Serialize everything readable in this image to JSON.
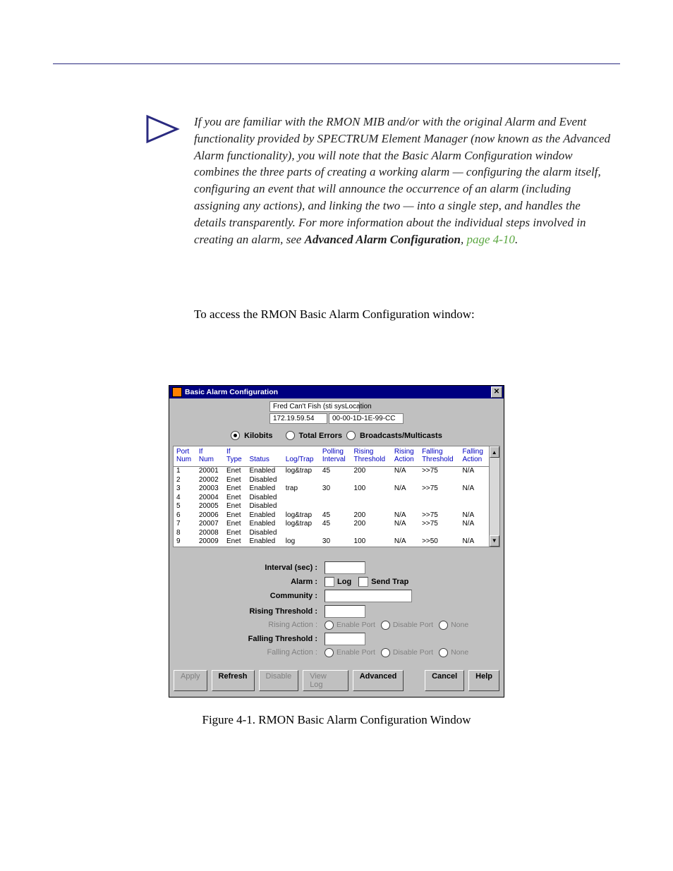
{
  "note": {
    "paragraph_pre": "If you are familiar with the RMON MIB and/or with the original Alarm and Event functionality provided by SPECTRUM Element Manager (now known as the Advanced Alarm functionality), you will note that the Basic Alarm Configuration window combines the three parts of creating a working alarm — configuring the alarm itself, configuring an event that will announce the occurrence of an alarm (including assigning any actions), and linking the two — into a single step, and handles the details transparently. For more information about the individual steps involved in creating an alarm, see ",
    "bold": "Advanced Alarm Configuration",
    "sep": ", ",
    "link": "page 4-10",
    "tail": "."
  },
  "access_line": "To access the RMON Basic Alarm Configuration window:",
  "win": {
    "title": "Basic Alarm Configuration",
    "close": "✕",
    "info": {
      "name": "Fred Can't Fish (sti sysLocation",
      "ip": "172.19.59.54",
      "mac": "00-00-1D-1E-99-CC"
    },
    "radios": {
      "kilobits": "Kilobits",
      "total_errors": "Total Errors",
      "bcast": "Broadcasts/Multicasts"
    },
    "headers": {
      "port_num": "Port\nNum",
      "if_num": "If\nNum",
      "if_type": "If\nType",
      "status": "Status",
      "log_trap": "Log/Trap",
      "polling": "Polling\nInterval",
      "rising_th": "Rising\nThreshold",
      "rising_ac": "Rising\nAction",
      "falling_th": "Falling\nThreshold",
      "falling_ac": "Falling\nAction"
    },
    "rows": [
      {
        "port": "1",
        "ifnum": "20001",
        "iftype": "Enet",
        "status": "Enabled",
        "lt": "log&trap",
        "poll": "45",
        "rth": "200",
        "rac": "N/A",
        "fth": ">>75",
        "fac": "N/A"
      },
      {
        "port": "2",
        "ifnum": "20002",
        "iftype": "Enet",
        "status": "Disabled",
        "lt": "",
        "poll": "",
        "rth": "",
        "rac": "",
        "fth": "",
        "fac": ""
      },
      {
        "port": "3",
        "ifnum": "20003",
        "iftype": "Enet",
        "status": "Enabled",
        "lt": "trap",
        "poll": "30",
        "rth": "100",
        "rac": "N/A",
        "fth": ">>75",
        "fac": "N/A"
      },
      {
        "port": "4",
        "ifnum": "20004",
        "iftype": "Enet",
        "status": "Disabled",
        "lt": "",
        "poll": "",
        "rth": "",
        "rac": "",
        "fth": "",
        "fac": ""
      },
      {
        "port": "5",
        "ifnum": "20005",
        "iftype": "Enet",
        "status": "Disabled",
        "lt": "",
        "poll": "",
        "rth": "",
        "rac": "",
        "fth": "",
        "fac": ""
      },
      {
        "port": "6",
        "ifnum": "20006",
        "iftype": "Enet",
        "status": "Enabled",
        "lt": "log&trap",
        "poll": "45",
        "rth": "200",
        "rac": "N/A",
        "fth": ">>75",
        "fac": "N/A"
      },
      {
        "port": "7",
        "ifnum": "20007",
        "iftype": "Enet",
        "status": "Enabled",
        "lt": "log&trap",
        "poll": "45",
        "rth": "200",
        "rac": "N/A",
        "fth": ">>75",
        "fac": "N/A"
      },
      {
        "port": "8",
        "ifnum": "20008",
        "iftype": "Enet",
        "status": "Disabled",
        "lt": "",
        "poll": "",
        "rth": "",
        "rac": "",
        "fth": "",
        "fac": ""
      },
      {
        "port": "9",
        "ifnum": "20009",
        "iftype": "Enet",
        "status": "Enabled",
        "lt": "log",
        "poll": "30",
        "rth": "100",
        "rac": "N/A",
        "fth": ">>50",
        "fac": "N/A"
      }
    ],
    "form": {
      "interval": "Interval (sec) :",
      "alarm": "Alarm :",
      "log": "Log",
      "send_trap": "Send Trap",
      "community": "Community :",
      "rising_th": "Rising Threshold :",
      "rising_ac": "Rising Action :",
      "falling_th": "Falling Threshold :",
      "falling_ac": "Falling Action :",
      "enable_port": "Enable Port",
      "disable_port": "Disable Port",
      "none": "None"
    },
    "buttons": {
      "apply": "Apply",
      "refresh": "Refresh",
      "disable": "Disable",
      "view_log": "View Log",
      "advanced": "Advanced",
      "cancel": "Cancel",
      "help": "Help"
    }
  },
  "caption": "Figure 4-1.  RMON Basic Alarm Configuration Window"
}
